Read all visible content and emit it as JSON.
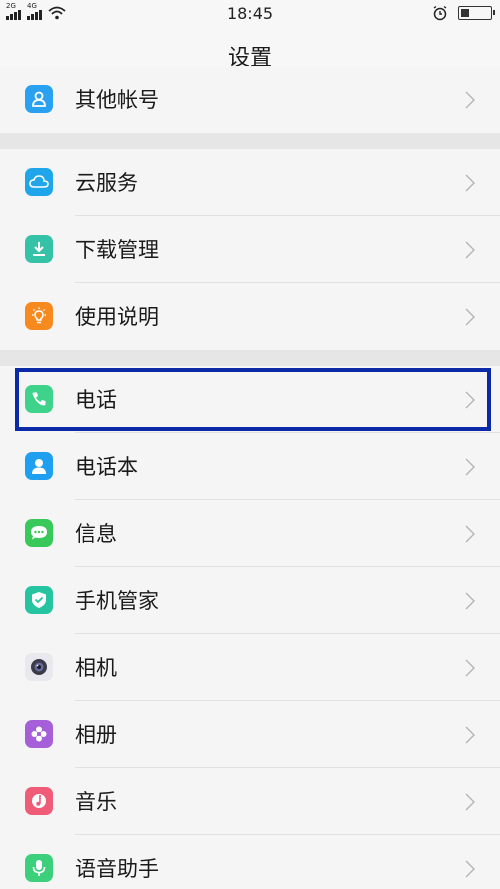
{
  "status_bar": {
    "sim1": "2G",
    "sim2": "4G",
    "time": "18:45",
    "battery_level": 0.3
  },
  "header": {
    "title": "设置"
  },
  "settings": {
    "items": [
      {
        "label": "其他帐号",
        "icon": "account-icon",
        "color": "#2aa0f0"
      },
      {
        "label": "云服务",
        "icon": "cloud-icon",
        "color": "#1fa6ea"
      },
      {
        "label": "下载管理",
        "icon": "download-icon",
        "color": "#35c2a6"
      },
      {
        "label": "使用说明",
        "icon": "lightbulb-icon",
        "color": "#f78a1f"
      },
      {
        "label": "电话",
        "icon": "phone-icon",
        "color": "#3ed28a"
      },
      {
        "label": "电话本",
        "icon": "contacts-icon",
        "color": "#1e9ff0"
      },
      {
        "label": "信息",
        "icon": "message-icon",
        "color": "#39c85a"
      },
      {
        "label": "手机管家",
        "icon": "shield-icon",
        "color": "#26c4a0"
      },
      {
        "label": "相机",
        "icon": "camera-icon",
        "color": "#e8e8ee"
      },
      {
        "label": "相册",
        "icon": "album-icon",
        "color": "#a55fd8"
      },
      {
        "label": "音乐",
        "icon": "music-icon",
        "color": "#f05c78"
      },
      {
        "label": "语音助手",
        "icon": "mic-icon",
        "color": "#3cd07c"
      }
    ]
  },
  "highlight": {
    "color": "#0a2aa8",
    "target": "电话"
  }
}
